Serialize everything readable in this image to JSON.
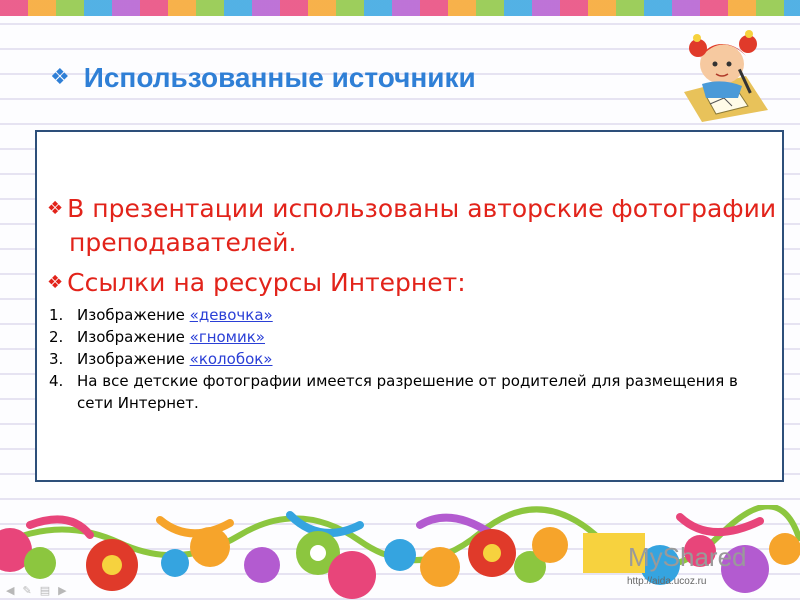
{
  "slide": {
    "title": "Использованные источники",
    "title_bullet": "❖",
    "bullets": [
      {
        "line1": "В презентации использованы авторские фотографии",
        "line2": "преподавателей."
      },
      {
        "line1": "Ссылки на ресурсы Интернет:"
      }
    ],
    "list": [
      {
        "num": "1.",
        "text": "Изображение ",
        "link": "«девочка»"
      },
      {
        "num": "2.",
        "text": "Изображение ",
        "link": "«гномик»"
      },
      {
        "num": "3.",
        "text": "Изображение ",
        "link": "«колобок»"
      },
      {
        "num": "4.",
        "text": "На все детские фотографии имеется разрешение от родителей для размещения в",
        "text2": "сети Интернет."
      }
    ]
  },
  "watermark": "MyShared",
  "footer_url": "http://aida.ucoz.ru",
  "colors": {
    "title": "#2f7fd6",
    "bullet_text": "#e2231a",
    "link": "#2a3fd6",
    "box_border": "#2d4f7a"
  }
}
